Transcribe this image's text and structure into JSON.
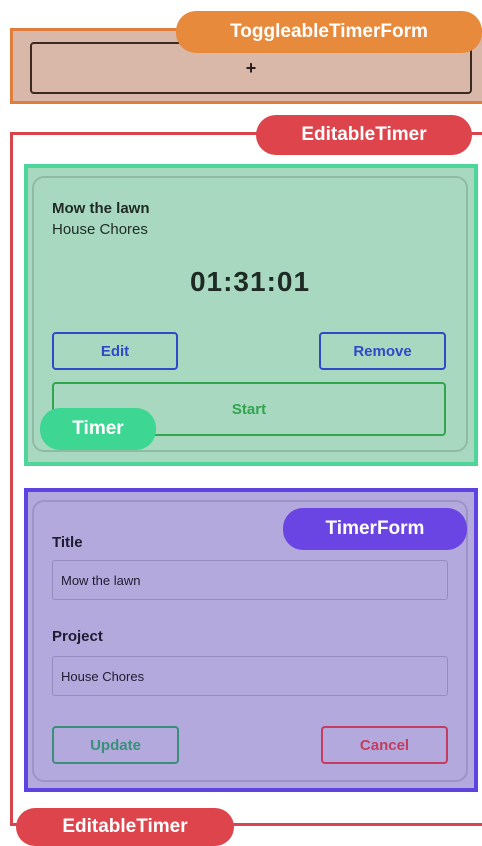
{
  "toggleable_timer_form": {
    "label": "ToggleableTimerForm",
    "add_button_label": "+"
  },
  "editable_timer": {
    "label_top": "EditableTimer",
    "label_bottom": "EditableTimer"
  },
  "timer": {
    "label": "Timer",
    "title": "Mow the lawn",
    "project": "House Chores",
    "elapsed": "01:31:01",
    "edit_label": "Edit",
    "remove_label": "Remove",
    "start_label": "Start"
  },
  "timer_form": {
    "label": "TimerForm",
    "title_label": "Title",
    "title_value": "Mow the lawn",
    "project_label": "Project",
    "project_value": "House Chores",
    "update_label": "Update",
    "cancel_label": "Cancel"
  },
  "colors": {
    "toggleable": "#e88a3c",
    "editable": "#de444b",
    "timer": "#3ed693",
    "timer_form": "#6a45e3"
  }
}
